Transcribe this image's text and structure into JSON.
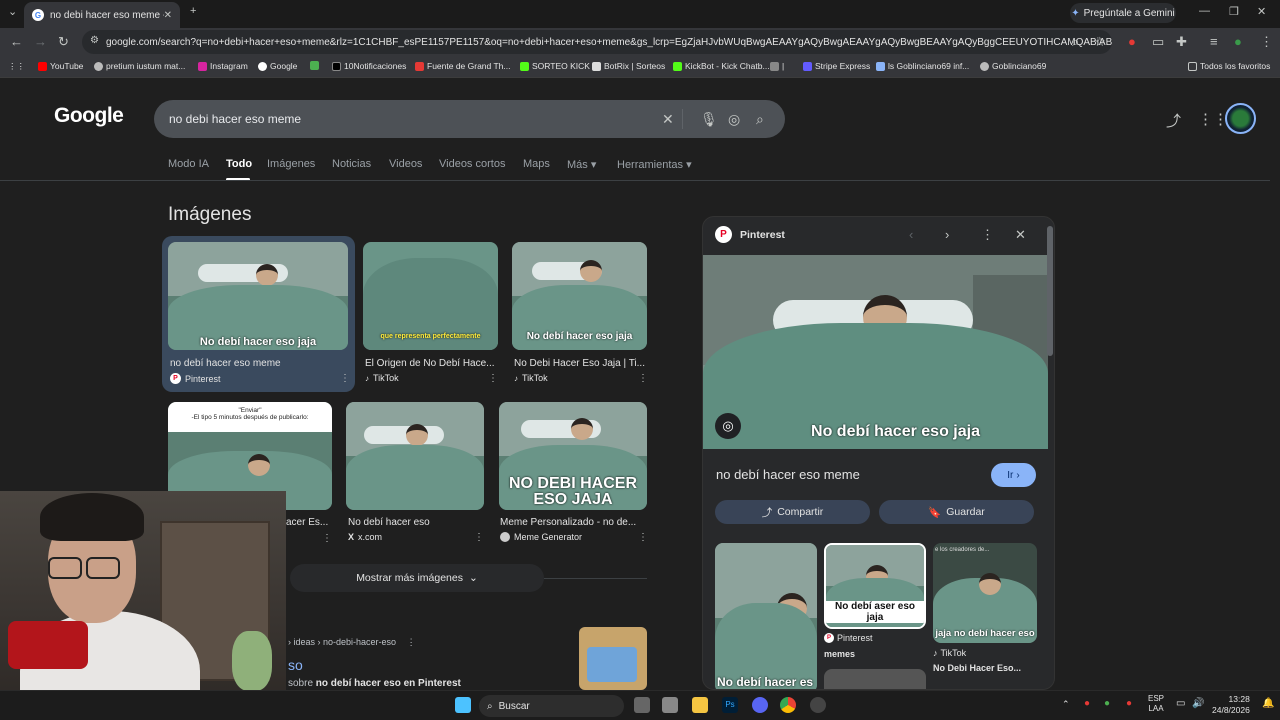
{
  "browser": {
    "tab_title": "no debi hacer eso meme - Busc",
    "gemini_label": "Pregúntale a Gemini",
    "url": "google.com/search?q=no+debi+hacer+eso+meme&rlz=1C1CHBF_esPE1157PE1157&oq=no+debi+hacer+eso+meme&gs_lcrp=EgZjaHJvbWUqBwgAEAAYgAQyBwgAEAAYgAQyBwgBEAAYgAQyBggCEEUYOTIHCAMQABiABDIHCAQQABiABDIHCA...",
    "bookmarks": [
      "YouTube",
      "pretium iustum mat...",
      "Instagram",
      "Google",
      "",
      "10Notificaciones",
      "Fuente de Grand Th...",
      "SORTEO KICK",
      "BotRix | Sorteos",
      "KickBot - Kick Chatb...",
      "|",
      "Stripe Express",
      "ls Goblinciano69 inf...",
      "Goblinciano69"
    ],
    "bookmarks_all": "Todos los favoritos"
  },
  "google": {
    "logo": "Google",
    "query": "no debi hacer eso meme",
    "tabs": [
      "Modo IA",
      "Todo",
      "Imágenes",
      "Noticias",
      "Videos",
      "Videos cortos",
      "Maps",
      "Más",
      "Herramientas"
    ],
    "images_heading": "Imágenes",
    "images": [
      {
        "title": "no debí hacer eso meme",
        "source": "Pinterest",
        "caption": "No debí hacer eso jaja"
      },
      {
        "title": "El Origen de No Debí Hace...",
        "source": "TikTok",
        "caption": "que representa perfectamente"
      },
      {
        "title": "No Debi Hacer Eso Jaja | Ti...",
        "source": "TikTok",
        "caption": "No debí hacer eso jaja"
      },
      {
        "title": "acer Es...",
        "source": "",
        "caption": "\"Enviar\"\n-El tipo 5 minutos después de publicarlo:"
      },
      {
        "title": "No debí hacer eso",
        "source": "x.com",
        "caption": ""
      },
      {
        "title": "Meme Personalizado - no de...",
        "source": "Meme Generator",
        "caption": "NO DEBI HACER ESO JAJA"
      }
    ],
    "more_images": "Mostrar más imágenes",
    "result": {
      "crumb": "› ideas › no-debi-hacer-eso",
      "title": "so",
      "snippet_prefix": "sobre",
      "snippet_bold": "no debí hacer eso en Pinterest"
    }
  },
  "panel": {
    "source": "Pinterest",
    "image_caption": "No debí hacer eso jaja",
    "title": "no debí hacer eso meme",
    "go_label": "Ir",
    "share_label": "Compartir",
    "save_label": "Guardar",
    "related": [
      {
        "caption": "No debí hacer es",
        "source": "",
        "title": ""
      },
      {
        "caption": "No debí aser eso jaja",
        "source": "Pinterest",
        "title": "memes"
      },
      {
        "caption": "jaja no debí hacer eso",
        "top_text": "e los creadores de...",
        "source": "TikTok",
        "title": "No Debi Hacer Eso..."
      }
    ]
  },
  "taskbar": {
    "search": "Buscar",
    "lang_top": "ESP",
    "lang_bottom": "LAA",
    "time": "13:28",
    "date": "24/8/2026"
  }
}
